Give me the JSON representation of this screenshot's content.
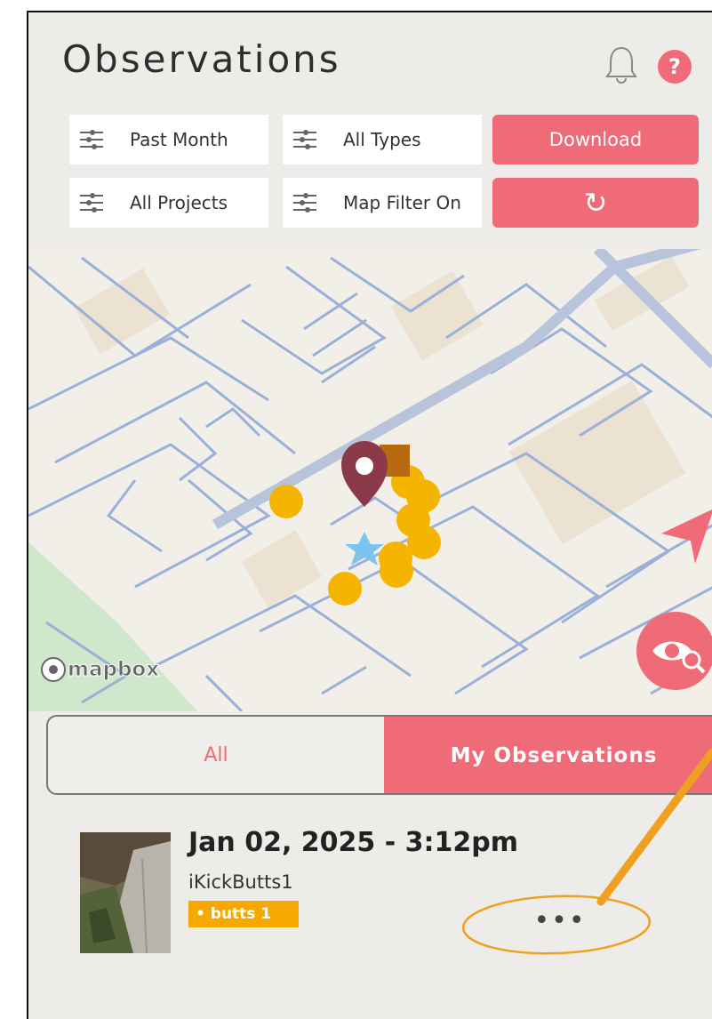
{
  "header": {
    "title": "Observations",
    "help_glyph": "?"
  },
  "filters": {
    "date": "Past Month",
    "types": "All Types",
    "projects": "All Projects",
    "map_filter": "Map Filter On",
    "download_label": "Download",
    "refresh_glyph": "↻"
  },
  "map": {
    "attribution": "mapbox",
    "markers": {
      "pin_color": "#8b3a4a",
      "dot_color": "#f5b400",
      "star_color": "#7cc3ee",
      "nav_arrow_color": "#ef6b77"
    }
  },
  "segment": {
    "all_label": "All",
    "mine_label": "My Observations",
    "active": "My Observations"
  },
  "observation": {
    "datetime": "Jan 02, 2025 - 3:12pm",
    "user": "iKickButts1",
    "tag_label": "• butts  1",
    "more_label": "•••"
  },
  "colors": {
    "accent": "#ef6b77",
    "background": "#eeece8",
    "annotation": "#f0a020"
  }
}
